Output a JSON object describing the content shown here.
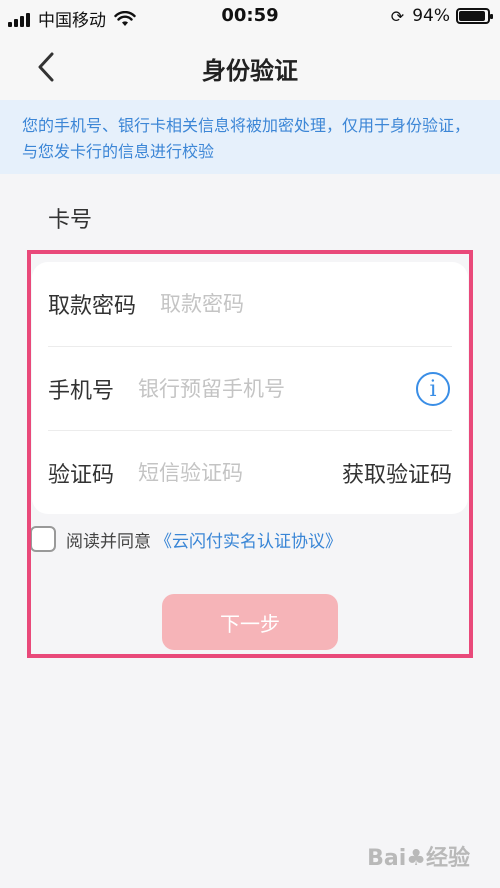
{
  "status_bar": {
    "carrier": "中国移动",
    "time": "00:59",
    "battery_percent": "94%",
    "battery_level": 0.94,
    "icons": [
      "signal-icon",
      "wifi-icon",
      "rotation-lock-icon",
      "battery-icon"
    ]
  },
  "nav": {
    "title": "身份验证",
    "back_icon": "chevron-left-icon"
  },
  "notice": {
    "text": "您的手机号、银行卡相关信息将被加密处理，仅用于身份验证，与您发卡行的信息进行校验"
  },
  "card": {
    "label": "卡号"
  },
  "form": {
    "pin_label": "取款密码",
    "pin_placeholder": "取款密码",
    "phone_label": "手机号",
    "phone_placeholder": "银行预留手机号",
    "info_icon_glyph": "i",
    "code_label": "验证码",
    "code_placeholder": "短信验证码",
    "get_code_label": "获取验证码"
  },
  "agreement": {
    "text": "阅读并同意",
    "link": "《云闪付实名认证协议》",
    "checked": false
  },
  "next_button": {
    "label": "下一步",
    "color": "#f6b4b8"
  },
  "highlight_color": "#e9497a",
  "accent_color": "#3a8ee6"
}
